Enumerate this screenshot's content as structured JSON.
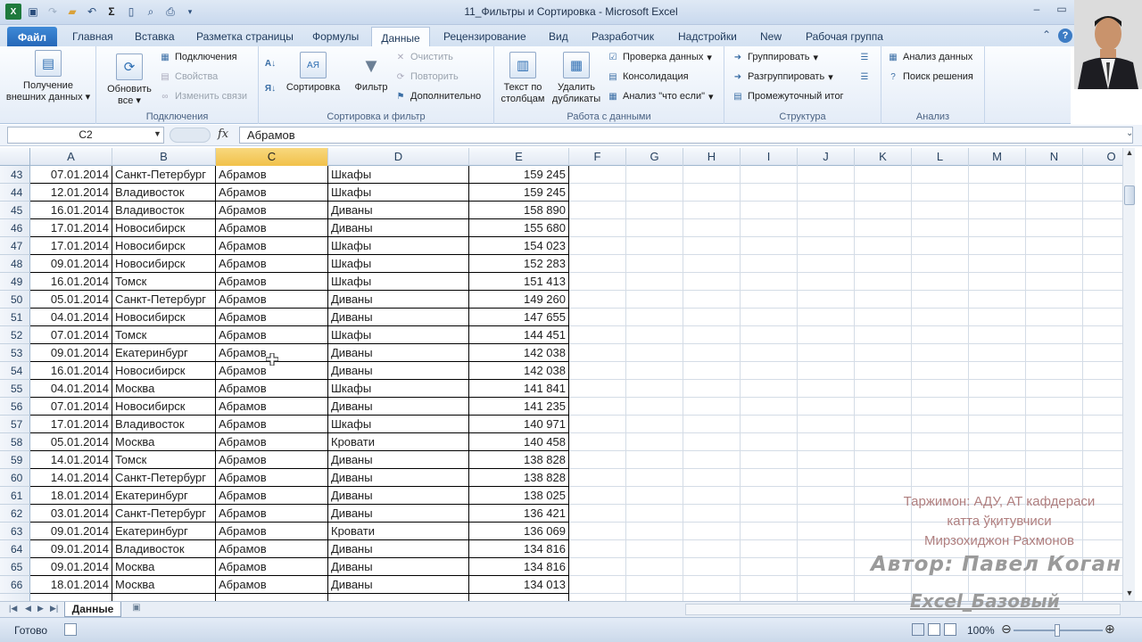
{
  "window": {
    "title": "11_Фильтры и Сортировка  -  Microsoft Excel"
  },
  "tabs": [
    "Файл",
    "Главная",
    "Вставка",
    "Разметка страницы",
    "Формулы",
    "Данные",
    "Рецензирование",
    "Вид",
    "Разработчик",
    "Надстройки",
    "New",
    "Рабочая группа"
  ],
  "ribbon": {
    "get_external": "Получение внешних данных",
    "refresh_all": "Обновить все",
    "connections": "Подключения",
    "properties": "Свойства",
    "edit_links": "Изменить связи",
    "group_connections": "Подключения",
    "sort": "Сортировка",
    "filter": "Фильтр",
    "clear": "Очистить",
    "reapply": "Повторить",
    "advanced": "Дополнительно",
    "group_sort": "Сортировка и фильтр",
    "text_to_columns": "Текст по столбцам",
    "remove_duplicates": "Удалить дубликаты",
    "data_validation": "Проверка данных",
    "consolidate": "Консолидация",
    "what_if": "Анализ \"что если\"",
    "group_data_tools": "Работа с данными",
    "group": "Группировать",
    "ungroup": "Разгруппировать",
    "subtotal": "Промежуточный итог",
    "group_outline": "Структура",
    "data_analysis": "Анализ данных",
    "solver": "Поиск решения",
    "group_analysis": "Анализ"
  },
  "formula_bar": {
    "name_box": "C2",
    "fx": "fx",
    "value": "Абрамов"
  },
  "columns": [
    "A",
    "B",
    "C",
    "D",
    "E",
    "F",
    "G",
    "H",
    "I",
    "J",
    "K",
    "L",
    "M",
    "N",
    "O"
  ],
  "selected_column": "C",
  "rows": [
    {
      "n": "43",
      "a": "07.01.2014",
      "b": "Санкт-Петербург",
      "c": "Абрамов",
      "d": "Шкафы",
      "e": "159 245"
    },
    {
      "n": "44",
      "a": "12.01.2014",
      "b": "Владивосток",
      "c": "Абрамов",
      "d": "Шкафы",
      "e": "159 245"
    },
    {
      "n": "45",
      "a": "16.01.2014",
      "b": "Владивосток",
      "c": "Абрамов",
      "d": "Диваны",
      "e": "158 890"
    },
    {
      "n": "46",
      "a": "17.01.2014",
      "b": "Новосибирск",
      "c": "Абрамов",
      "d": "Диваны",
      "e": "155 680"
    },
    {
      "n": "47",
      "a": "17.01.2014",
      "b": "Новосибирск",
      "c": "Абрамов",
      "d": "Шкафы",
      "e": "154 023"
    },
    {
      "n": "48",
      "a": "09.01.2014",
      "b": "Новосибирск",
      "c": "Абрамов",
      "d": "Шкафы",
      "e": "152 283"
    },
    {
      "n": "49",
      "a": "16.01.2014",
      "b": "Томск",
      "c": "Абрамов",
      "d": "Шкафы",
      "e": "151 413"
    },
    {
      "n": "50",
      "a": "05.01.2014",
      "b": "Санкт-Петербург",
      "c": "Абрамов",
      "d": "Диваны",
      "e": "149 260"
    },
    {
      "n": "51",
      "a": "04.01.2014",
      "b": "Новосибирск",
      "c": "Абрамов",
      "d": "Диваны",
      "e": "147 655"
    },
    {
      "n": "52",
      "a": "07.01.2014",
      "b": "Томск",
      "c": "Абрамов",
      "d": "Шкафы",
      "e": "144 451"
    },
    {
      "n": "53",
      "a": "09.01.2014",
      "b": "Екатеринбург",
      "c": "Абрамов",
      "d": "Диваны",
      "e": "142 038"
    },
    {
      "n": "54",
      "a": "16.01.2014",
      "b": "Новосибирск",
      "c": "Абрамов",
      "d": "Диваны",
      "e": "142 038"
    },
    {
      "n": "55",
      "a": "04.01.2014",
      "b": "Москва",
      "c": "Абрамов",
      "d": "Шкафы",
      "e": "141 841"
    },
    {
      "n": "56",
      "a": "07.01.2014",
      "b": "Новосибирск",
      "c": "Абрамов",
      "d": "Диваны",
      "e": "141 235"
    },
    {
      "n": "57",
      "a": "17.01.2014",
      "b": "Владивосток",
      "c": "Абрамов",
      "d": "Шкафы",
      "e": "140 971"
    },
    {
      "n": "58",
      "a": "05.01.2014",
      "b": "Москва",
      "c": "Абрамов",
      "d": "Кровати",
      "e": "140 458"
    },
    {
      "n": "59",
      "a": "14.01.2014",
      "b": "Томск",
      "c": "Абрамов",
      "d": "Диваны",
      "e": "138 828"
    },
    {
      "n": "60",
      "a": "14.01.2014",
      "b": "Санкт-Петербург",
      "c": "Абрамов",
      "d": "Диваны",
      "e": "138 828"
    },
    {
      "n": "61",
      "a": "18.01.2014",
      "b": "Екатеринбург",
      "c": "Абрамов",
      "d": "Диваны",
      "e": "138 025"
    },
    {
      "n": "62",
      "a": "03.01.2014",
      "b": "Санкт-Петербург",
      "c": "Абрамов",
      "d": "Диваны",
      "e": "136 421"
    },
    {
      "n": "63",
      "a": "09.01.2014",
      "b": "Екатеринбург",
      "c": "Абрамов",
      "d": "Кровати",
      "e": "136 069"
    },
    {
      "n": "64",
      "a": "09.01.2014",
      "b": "Владивосток",
      "c": "Абрамов",
      "d": "Диваны",
      "e": "134 816"
    },
    {
      "n": "65",
      "a": "09.01.2014",
      "b": "Москва",
      "c": "Абрамов",
      "d": "Диваны",
      "e": "134 816"
    },
    {
      "n": "66",
      "a": "18.01.2014",
      "b": "Москва",
      "c": "Абрамов",
      "d": "Диваны",
      "e": "134 013"
    }
  ],
  "sheet_tab": "Данные",
  "status": {
    "ready": "Готово",
    "zoom": "100%"
  },
  "overlay": {
    "credit_lines": [
      "Таржимон: АДУ, АТ кафдераси",
      "катта ўқитувчиси",
      "Мирзохиджон Рахмонов"
    ],
    "author": "Автор: Павел Коган",
    "course": "Excel_Базовый"
  },
  "colors": {
    "selected_header": "#f1c14a",
    "file_tab": "#2567b8",
    "credit_text": "#b07f7f"
  },
  "icons": [
    "save-icon",
    "undo-icon",
    "open-folder-icon",
    "sum-icon",
    "new-doc-icon",
    "print-preview-icon",
    "print-icon",
    "filter-funnel-icon",
    "sort-az-icon",
    "refresh-icon"
  ]
}
